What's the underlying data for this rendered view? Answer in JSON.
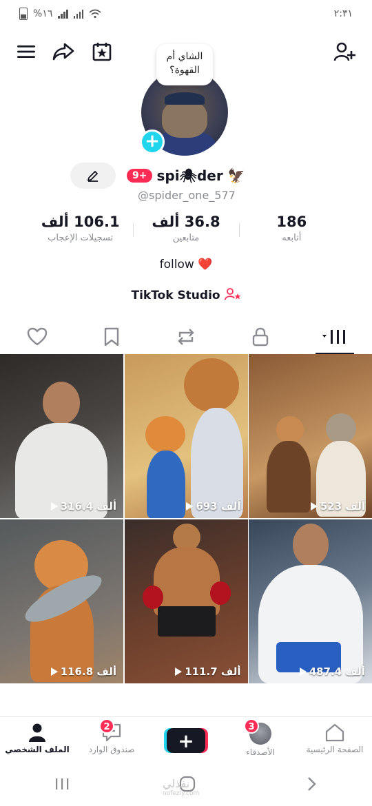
{
  "status_bar": {
    "battery_percent": "%١٦",
    "time": "٢:٣١"
  },
  "top_bar": {
    "menu_icon": "hamburger-icon",
    "share_icon": "share-icon",
    "calendar_icon": "calendar-star-icon",
    "add_friend_icon": "add-person-icon"
  },
  "profile": {
    "bubble_text_line1": "الشاي أم",
    "bubble_text_line2": "القهوة؟",
    "notification_count": "9+",
    "display_name": "spi🕷der 🦅",
    "username": "@spider_one_577",
    "bio_text": "follow",
    "bio_emoji": "❤️",
    "studio_label": "TikTok Studio"
  },
  "stats": [
    {
      "value": "106.1 ألف",
      "label": "تسجيلات الإعجاب"
    },
    {
      "value": "36.8 ألف",
      "label": "متابعين"
    },
    {
      "value": "186",
      "label": "أتابعه"
    }
  ],
  "tabs": [
    {
      "name": "liked",
      "icon": "heart-icon"
    },
    {
      "name": "saved",
      "icon": "bookmark-icon"
    },
    {
      "name": "reposts",
      "icon": "repost-icon"
    },
    {
      "name": "private",
      "icon": "lock-icon"
    },
    {
      "name": "videos",
      "icon": "grid-bars-icon",
      "active": true
    }
  ],
  "videos": [
    {
      "views": "316.4 ألف",
      "colors": [
        "#2e2a27",
        "#7a7a78"
      ],
      "subject": "man-in-white-shirt"
    },
    {
      "views": "693 ألف",
      "colors": [
        "#c89a5c",
        "#e3c17e"
      ],
      "subject": "lion-and-cat-store"
    },
    {
      "views": "523 ألف",
      "colors": [
        "#8a5a36",
        "#c79863"
      ],
      "subject": "cats-in-room"
    },
    {
      "views": "116.8 ألف",
      "colors": [
        "#555a5c",
        "#a08468"
      ],
      "subject": "kitten-with-fish"
    },
    {
      "views": "111.7 ألف",
      "colors": [
        "#3a2d2a",
        "#8a5036"
      ],
      "subject": "boxer-cat"
    },
    {
      "views": "487.4 ألف",
      "colors": [
        "#38465a",
        "#d8dde3"
      ],
      "subject": "man-in-store"
    }
  ],
  "bottom_nav": [
    {
      "label": "الملف الشخصي",
      "icon": "profile-icon",
      "active": true
    },
    {
      "label": "صندوق الوارد",
      "icon": "inbox-icon",
      "badge": "2"
    },
    {
      "label": "",
      "icon": "create-icon",
      "create": true
    },
    {
      "label": "الأصدقاء",
      "icon": "friends-avatar",
      "badge": "3"
    },
    {
      "label": "الصفحة الرئيسية",
      "icon": "home-icon"
    }
  ],
  "watermark": {
    "text": "نفذلي",
    "sub": "nofezly.com"
  },
  "colors": {
    "accent_pink": "#fe2c55",
    "accent_cyan": "#20d5ec",
    "text": "#161823",
    "muted": "#8a8b91"
  }
}
